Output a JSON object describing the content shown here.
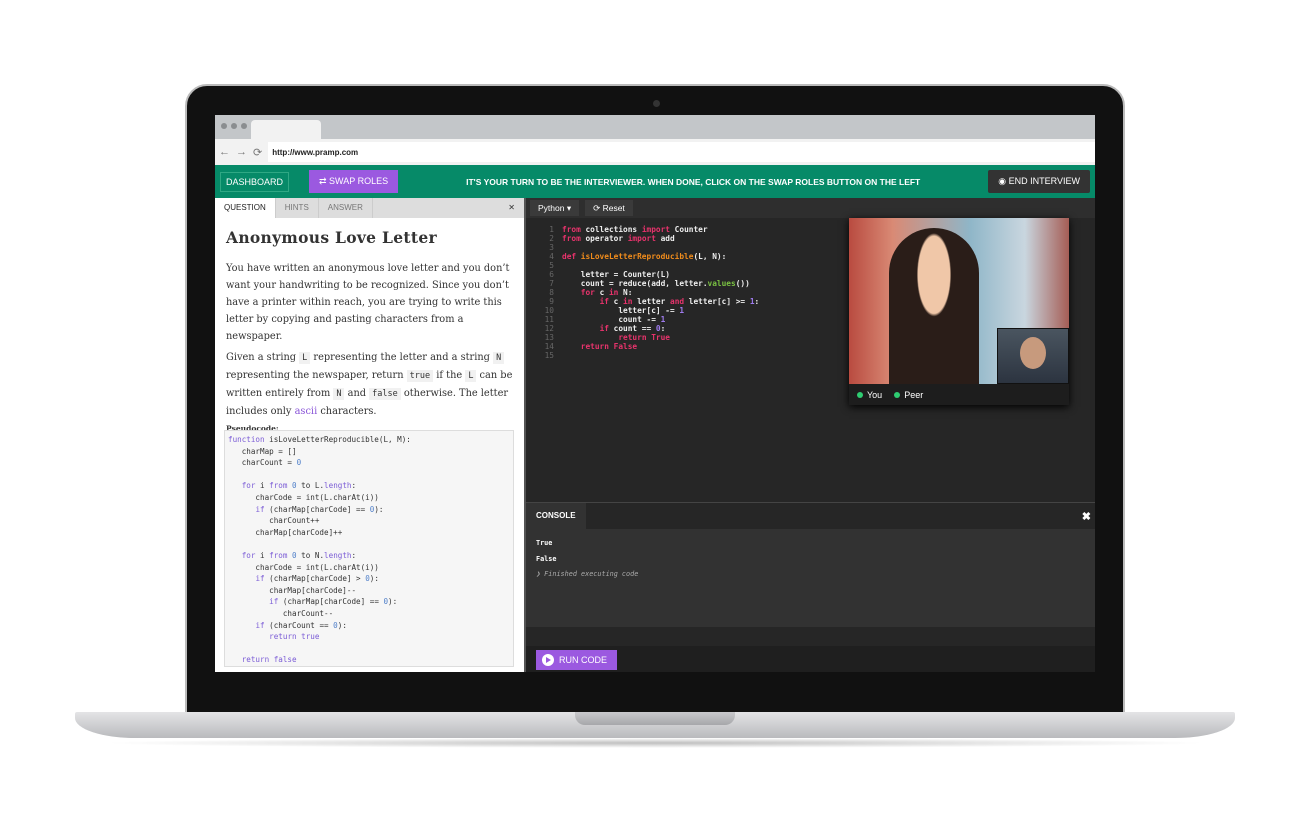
{
  "browser": {
    "url": "http://www.pramp.com"
  },
  "topbar": {
    "dashboard": "DASHBOARD",
    "swap_roles": "⇄ SWAP ROLES",
    "message": "IT'S YOUR TURN TO BE THE INTERVIEWER. WHEN DONE, CLICK ON THE SWAP ROLES BUTTON ON THE LEFT",
    "end_interview": "END INTERVIEW",
    "accent": "#068a68",
    "button_color": "#9b59e0"
  },
  "left": {
    "tabs": [
      "QUESTION",
      "HINTS",
      "ANSWER"
    ],
    "close": "✕",
    "title": "Anonymous Love Letter",
    "p1": "You have written an anonymous love letter and you don’t want your handwriting to be recognized. Since you don’t have a printer within reach, you are trying to write this letter by copying and pasting characters from a newspaper.",
    "p2": [
      "Given a string ",
      "L",
      " representing the letter and a string ",
      "N",
      " representing the newspaper, return ",
      "true",
      " if the ",
      "L",
      " can be written entirely from ",
      "N",
      " and ",
      "false",
      " otherwise. The letter includes only ",
      "ascii",
      " characters."
    ],
    "pseudocode_label": "Pseudocode:",
    "pseudocode": [
      [
        [
          "function ",
          "kw"
        ],
        [
          "isLoveLetterReproducible(L, M):",
          ""
        ]
      ],
      [
        [
          "   charMap = []",
          ""
        ]
      ],
      [
        [
          "   charCount = ",
          ""
        ],
        [
          "0",
          "nm"
        ]
      ],
      [
        [
          "",
          ""
        ]
      ],
      [
        [
          "   ",
          ""
        ],
        [
          "for",
          "kw"
        ],
        [
          " i ",
          ""
        ],
        [
          "from",
          "kw"
        ],
        [
          " ",
          ""
        ],
        [
          "0",
          "nm"
        ],
        [
          " to L.",
          ""
        ],
        [
          "length",
          "kw"
        ],
        [
          ":",
          ""
        ]
      ],
      [
        [
          "      charCode = int(L.charAt(i))",
          ""
        ]
      ],
      [
        [
          "      ",
          ""
        ],
        [
          "if",
          "kw"
        ],
        [
          " (charMap[charCode] == ",
          ""
        ],
        [
          "0",
          "nm"
        ],
        [
          "):",
          ""
        ]
      ],
      [
        [
          "         charCount++",
          ""
        ]
      ],
      [
        [
          "      charMap[charCode]++",
          ""
        ]
      ],
      [
        [
          "",
          ""
        ]
      ],
      [
        [
          "   ",
          ""
        ],
        [
          "for",
          "kw"
        ],
        [
          " i ",
          ""
        ],
        [
          "from",
          "kw"
        ],
        [
          " ",
          ""
        ],
        [
          "0",
          "nm"
        ],
        [
          " to N.",
          ""
        ],
        [
          "length",
          "kw"
        ],
        [
          ":",
          ""
        ]
      ],
      [
        [
          "      charCode = int(L.charAt(i))",
          ""
        ]
      ],
      [
        [
          "      ",
          ""
        ],
        [
          "if",
          "kw"
        ],
        [
          " (charMap[charCode] > ",
          ""
        ],
        [
          "0",
          "nm"
        ],
        [
          "):",
          ""
        ]
      ],
      [
        [
          "         charMap[charCode]--",
          ""
        ]
      ],
      [
        [
          "         ",
          ""
        ],
        [
          "if",
          "kw"
        ],
        [
          " (charMap[charCode] == ",
          ""
        ],
        [
          "0",
          "nm"
        ],
        [
          "):",
          ""
        ]
      ],
      [
        [
          "            charCount--",
          ""
        ]
      ],
      [
        [
          "      ",
          ""
        ],
        [
          "if",
          "kw"
        ],
        [
          " (charCount == ",
          ""
        ],
        [
          "0",
          "nm"
        ],
        [
          "):",
          ""
        ]
      ],
      [
        [
          "         ",
          ""
        ],
        [
          "return true",
          "kw"
        ]
      ],
      [
        [
          "",
          ""
        ]
      ],
      [
        [
          "   ",
          ""
        ],
        [
          "return false",
          "kw"
        ]
      ]
    ]
  },
  "editor": {
    "language": "Python ▾",
    "reset": "⟳ Reset",
    "lines": [
      [
        [
          "from",
          "p"
        ],
        [
          " collections ",
          ""
        ],
        [
          "import",
          "p"
        ],
        [
          " Counter",
          ""
        ]
      ],
      [
        [
          "from",
          "p"
        ],
        [
          " operator ",
          ""
        ],
        [
          "import",
          "p"
        ],
        [
          " add",
          ""
        ]
      ],
      [],
      [
        [
          "def ",
          "p"
        ],
        [
          "isLoveLetterReproducible",
          "f"
        ],
        [
          "(L, N):",
          ""
        ]
      ],
      [],
      [
        [
          "    letter = Counter(L)",
          ""
        ]
      ],
      [
        [
          "    count = reduce(add, letter.",
          ""
        ],
        [
          "values",
          "g"
        ],
        [
          "())",
          ""
        ]
      ],
      [
        [
          "    ",
          ""
        ],
        [
          "for",
          "p"
        ],
        [
          " c ",
          ""
        ],
        [
          "in",
          "p"
        ],
        [
          " N:",
          ""
        ]
      ],
      [
        [
          "        ",
          ""
        ],
        [
          "if",
          "p"
        ],
        [
          " c ",
          ""
        ],
        [
          "in",
          "p"
        ],
        [
          " letter ",
          ""
        ],
        [
          "and",
          "p"
        ],
        [
          " letter[c] >= ",
          ""
        ],
        [
          "1",
          "v"
        ],
        [
          ":",
          ""
        ]
      ],
      [
        [
          "            letter[c] -= ",
          ""
        ],
        [
          "1",
          "v"
        ]
      ],
      [
        [
          "            count -= ",
          ""
        ],
        [
          "1",
          "v"
        ]
      ],
      [
        [
          "        ",
          ""
        ],
        [
          "if",
          "p"
        ],
        [
          " count == ",
          ""
        ],
        [
          "0",
          "v"
        ],
        [
          ":",
          ""
        ]
      ],
      [
        [
          "            ",
          ""
        ],
        [
          "return True",
          "p"
        ]
      ],
      [
        [
          "    ",
          ""
        ],
        [
          "return False",
          "p"
        ]
      ],
      []
    ]
  },
  "video": {
    "you": "You",
    "peer": "Peer"
  },
  "console": {
    "title": "CONSOLE",
    "close": "✖",
    "output": [
      "True",
      "False"
    ],
    "status": "❯ Finished executing code",
    "run": "RUN CODE"
  }
}
